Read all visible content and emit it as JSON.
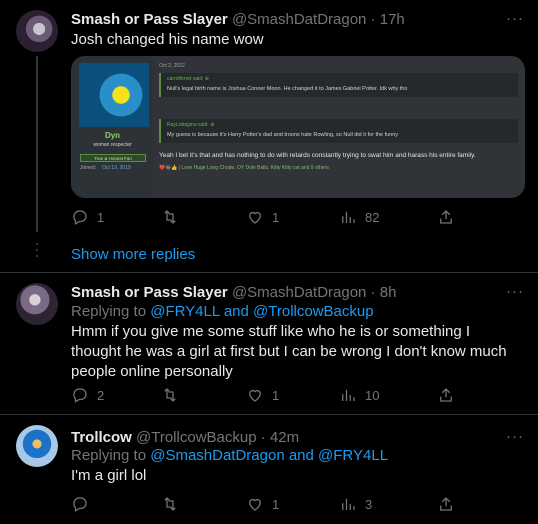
{
  "tweets": [
    {
      "name": "Smash or Pass Slayer",
      "handle": "@SmashDatDragon",
      "dot": "·",
      "time": "17h",
      "text": "Josh changed his name wow",
      "embed": {
        "date": "Oct 2, 2022",
        "username": "Dyn",
        "user_title": "woman respecter",
        "badge": "True & Honest Fan",
        "joined_label": "Joined:",
        "joined_date": "Oct 19, 2019",
        "quote1_header": "carrotferret said: ⊕",
        "quote1_body": "Null's legal birth name is Joshua Conner Moon. He changed it to James Gabriel Potter. Idk why tho",
        "quote2_header": "RayLobagma said: ⊕",
        "quote2_body": "My guess is because it's Harry Potter's dad and troons hate Rowling, so Null did it for the funny",
        "reply": "Yeah I bet it's that and has nothing to do with retards constantly trying to swat him and harass his entire family.",
        "reactions": "❤️😂👍 | Love Huge Long Chode, OY Dole Balls, Kitty Kitty cat and 9 others"
      },
      "actions": {
        "replies": "1",
        "retweets": "",
        "likes": "1",
        "views": "82"
      }
    },
    {
      "name": "Smash or Pass Slayer",
      "handle": "@SmashDatDragon",
      "dot": "·",
      "time": "8h",
      "replying_label": "Replying to",
      "mention1": "@FRY4LL",
      "and": "and",
      "mention2": "@TrollcowBackup",
      "text": "Hmm if you give me some stuff like who he is or something I thought he was a girl at first but I can be wrong I don't know much people online personally",
      "actions": {
        "replies": "2",
        "retweets": "",
        "likes": "1",
        "views": "10"
      }
    },
    {
      "name": "Trollcow",
      "handle": "@TrollcowBackup",
      "dot": "·",
      "time": "42m",
      "replying_label": "Replying to",
      "mention1": "@SmashDatDragon",
      "and": "and",
      "mention2": "@FRY4LL",
      "text": "I'm a girl lol",
      "actions": {
        "replies": "",
        "retweets": "",
        "likes": "1",
        "views": "3"
      }
    }
  ],
  "show_more": "Show more replies",
  "more_glyph": "···",
  "icons": [
    "reply-icon",
    "retweet-icon",
    "like-icon",
    "views-icon",
    "share-icon"
  ],
  "colors": {
    "background": "#000000",
    "accent": "#1d9bf0",
    "muted": "#71767b",
    "text": "#e7e9ea"
  }
}
